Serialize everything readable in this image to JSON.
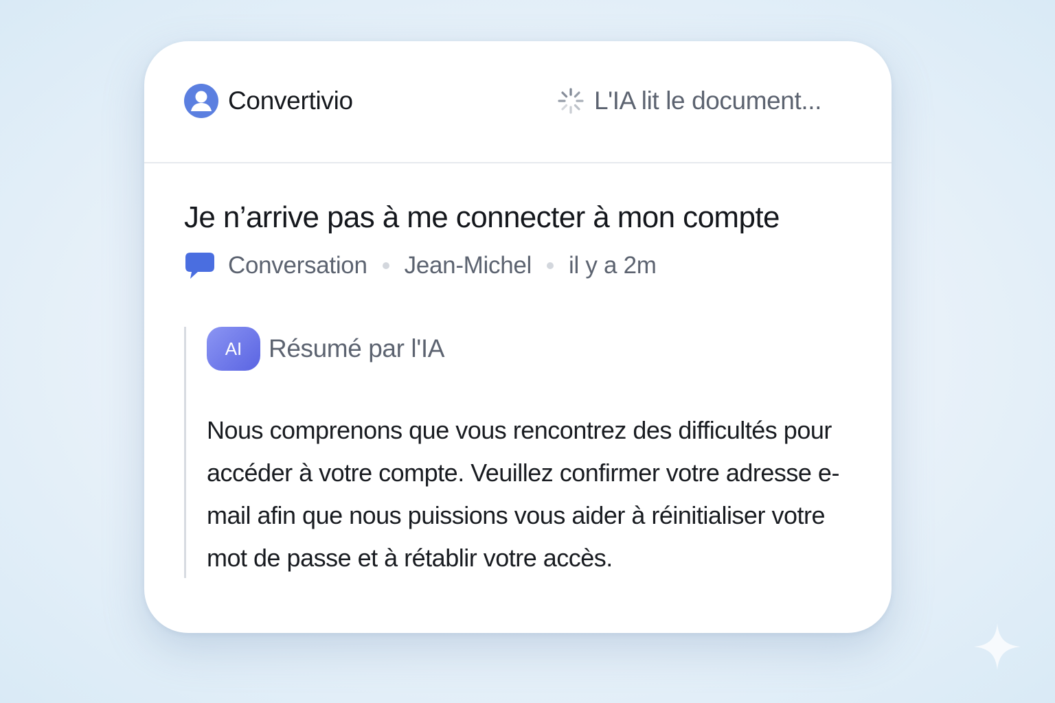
{
  "header": {
    "brand_name": "Convertivio",
    "brand_icon": "user-avatar-icon",
    "status_text": "L'IA lit le document...",
    "status_icon": "loading-spinner-icon"
  },
  "ticket": {
    "title": "Je n’arrive pas à me connecter à mon compte",
    "type_icon": "chat-bubble-icon",
    "type_label": "Conversation",
    "author": "Jean-Michel",
    "time": "il y a 2m"
  },
  "summary": {
    "badge": "AI",
    "label": "Résumé par l'IA",
    "text": "Nous comprenons que vous rencontrez des difficultés pour accéder à votre compte. Veuillez confirmer votre adresse e-mail afin que nous puissions vous aider à réinitialiser votre mot de passe et à rétablir votre accès."
  },
  "colors": {
    "brand_blue": "#5b7fe0",
    "chat_blue": "#4a6ee0",
    "ai_gradient_start": "#8b95f3",
    "ai_gradient_end": "#5a64e2",
    "muted_text": "#5c6370"
  },
  "decor": {
    "corner_icon": "sparkle-icon"
  }
}
